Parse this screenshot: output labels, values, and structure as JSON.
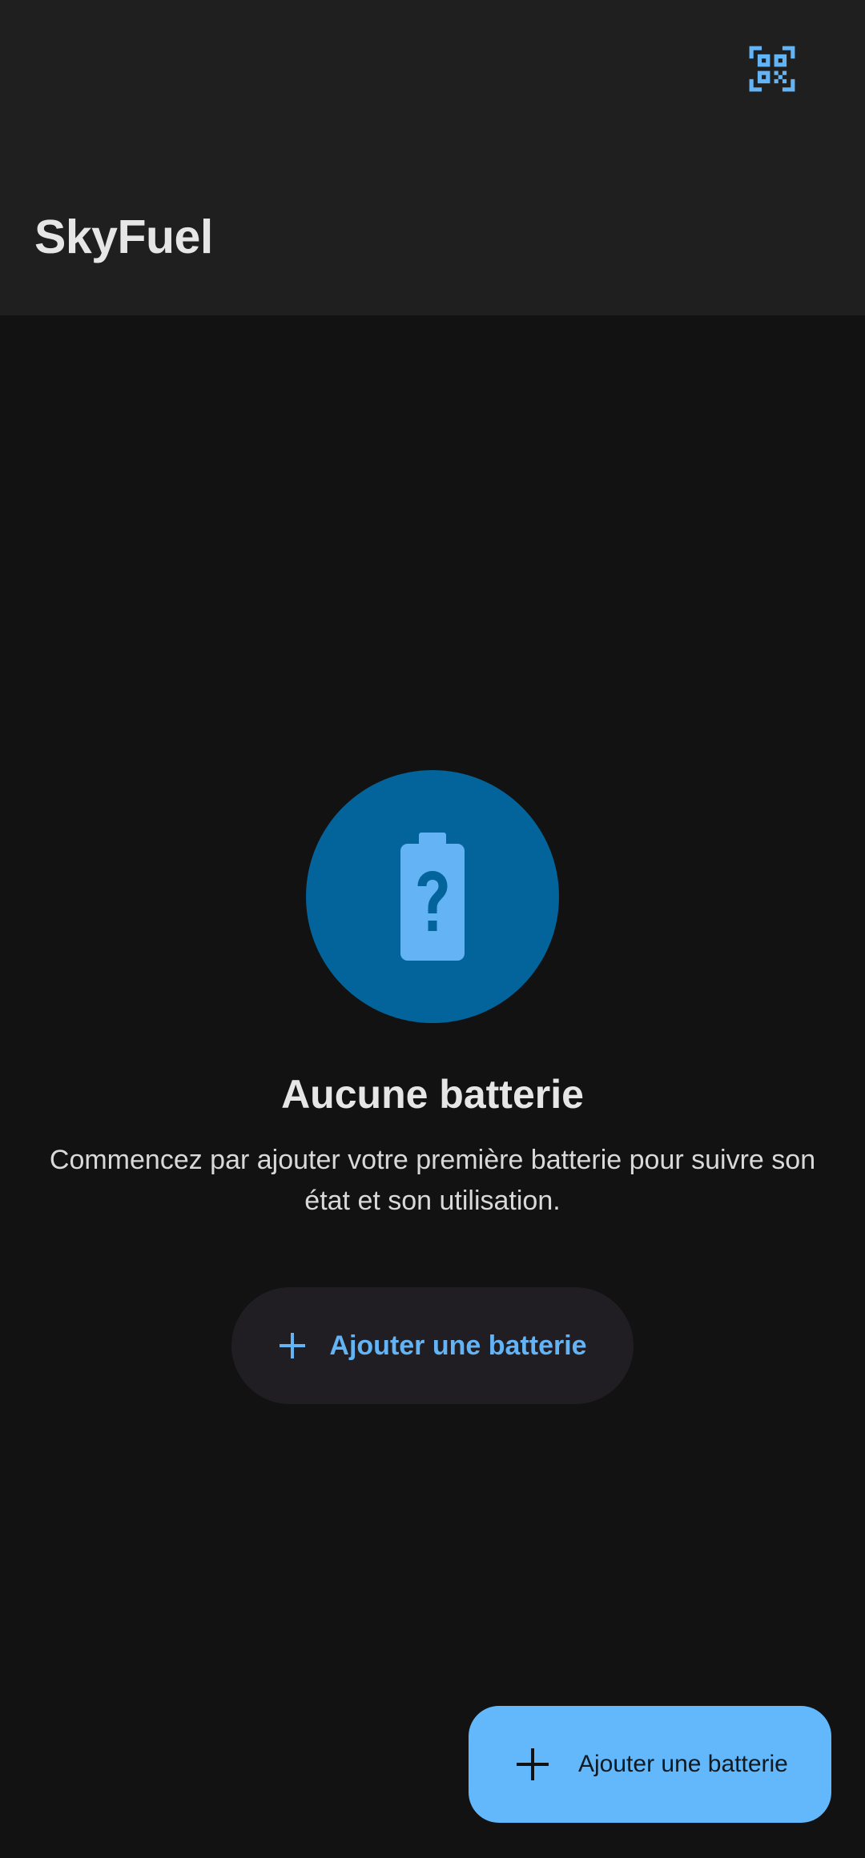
{
  "app_bar": {
    "title": "SkyFuel",
    "scan_icon": "qr-code-scanner-icon"
  },
  "empty_state": {
    "icon": "battery-unknown-icon",
    "title": "Aucune batterie",
    "description": "Commencez par ajouter votre première batterie pour suivre son état et son utilisation.",
    "button_label": "Ajouter une batterie",
    "button_icon": "plus-icon"
  },
  "fab": {
    "label": "Ajouter une batterie",
    "icon": "plus-icon"
  },
  "colors": {
    "background": "#121212",
    "app_bar": "#1f1f1f",
    "accent": "#64b4f5",
    "icon_circle": "#02649b",
    "fab": "#62b8fa"
  }
}
